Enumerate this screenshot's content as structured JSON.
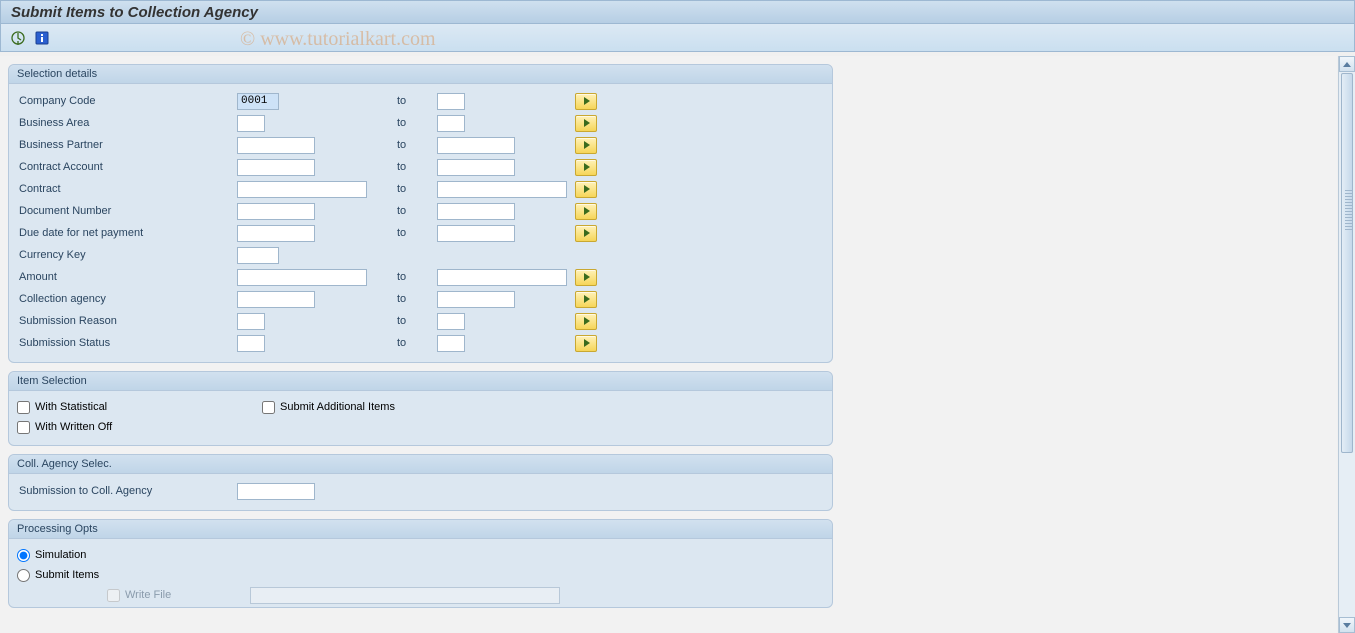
{
  "title": "Submit Items to Collection Agency",
  "watermark": "© www.tutorialkart.com",
  "to_label": "to",
  "groups": {
    "selection": {
      "title": "Selection details",
      "rows": {
        "company_code": {
          "label": "Company Code",
          "from": "0001",
          "to": ""
        },
        "business_area": {
          "label": "Business Area",
          "from": "",
          "to": ""
        },
        "business_partner": {
          "label": "Business Partner",
          "from": "",
          "to": ""
        },
        "contract_account": {
          "label": "Contract Account",
          "from": "",
          "to": ""
        },
        "contract": {
          "label": "Contract",
          "from": "",
          "to": ""
        },
        "document_number": {
          "label": "Document Number",
          "from": "",
          "to": ""
        },
        "due_date": {
          "label": "Due date for net payment",
          "from": "",
          "to": ""
        },
        "currency_key": {
          "label": "Currency Key",
          "from": ""
        },
        "amount": {
          "label": "Amount",
          "from": "",
          "to": ""
        },
        "collection_agency": {
          "label": "Collection agency",
          "from": "",
          "to": ""
        },
        "submission_reason": {
          "label": "Submission Reason",
          "from": "",
          "to": ""
        },
        "submission_status": {
          "label": "Submission Status",
          "from": "",
          "to": ""
        }
      }
    },
    "item_selection": {
      "title": "Item Selection",
      "with_statistical": "With Statistical",
      "with_written_off": "With Written Off",
      "submit_additional": "Submit Additional Items"
    },
    "coll_agency": {
      "title": "Coll. Agency Selec.",
      "submission_label": "Submission to Coll. Agency",
      "submission_value": ""
    },
    "processing": {
      "title": "Processing Opts",
      "simulation": "Simulation",
      "submit_items": "Submit Items",
      "write_file": "Write File",
      "file_value": ""
    }
  }
}
